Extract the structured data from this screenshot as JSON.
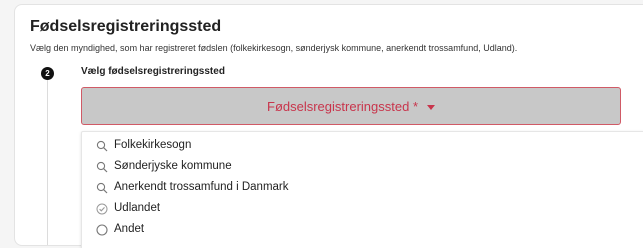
{
  "section": {
    "title": "Fødselsregistreringssted",
    "subtitle": "Vælg den myndighed, som har registreret fødslen (folkekirkesogn, sønderjysk kommune, anerkendt trossamfund, Udland)."
  },
  "step": {
    "number": "2",
    "label": "Vælg fødselsregistreringssted"
  },
  "select": {
    "placeholder": "Fødselsregistreringssted *",
    "caret_icon": "caret-down-icon",
    "accent_color": "#c8354c"
  },
  "options": [
    {
      "label": "Folkekirkesogn",
      "icon": "search-icon"
    },
    {
      "label": "Sønderjyske kommune",
      "icon": "search-icon"
    },
    {
      "label": "Anerkendt trossamfund i Danmark",
      "icon": "search-icon"
    },
    {
      "label": "Udlandet",
      "icon": "check-circle-icon"
    },
    {
      "label": "Andet",
      "icon": "radio-circle-icon"
    }
  ]
}
